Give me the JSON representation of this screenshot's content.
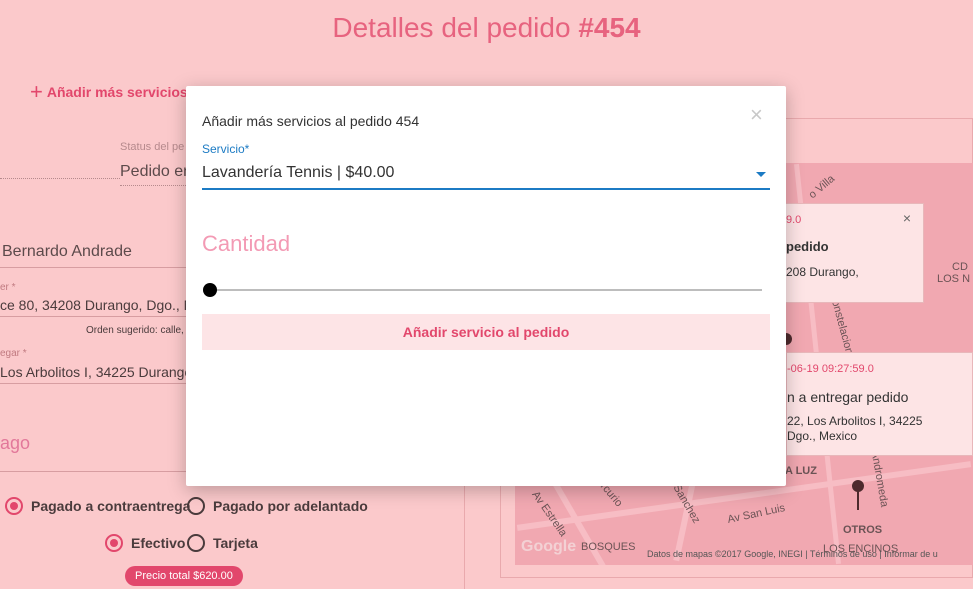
{
  "page": {
    "title_prefix": "Detalles del pedido",
    "title_number": "#454",
    "add_services_link": "Añadir más servicios"
  },
  "order_form": {
    "status_label": "Status del pe",
    "status_value": "Pedido en",
    "client_name": "Bernardo Andrade",
    "pickup_label": "er *",
    "pickup_address": "ce 80, 34208 Durango, Dgo., M",
    "order_hint": "Orden sugerido: calle,",
    "delivery_label": "egar *",
    "delivery_address": "Los Arbolitos I, 34225 Durango",
    "payment_title": "ago",
    "payment_options": [
      "Pagado a contraentrega",
      "Pagado por adelantado"
    ],
    "payment_selected": "Pagado a contraentrega",
    "method_options": [
      "Efectivo",
      "Tarjeta"
    ],
    "method_selected": "Efectivo",
    "total_badge": "Precio total $620.00"
  },
  "map": {
    "info1": {
      "date": "9.0",
      "title": "pedido",
      "address": "208 Durango,",
      "close": "×"
    },
    "info2": {
      "date": "-06-19 09:27:59.0",
      "title": "n a entregar pedido",
      "address_line1": "22, Los Arbolitos I, 34225",
      "address_line2": "Dgo., Mexico"
    },
    "labels": {
      "villa": "o Villa",
      "cd": "CD",
      "los_n": "LOS N",
      "luz": "A LUZ",
      "otros": "OTROS",
      "los_encinos": "LOS ENCINOS",
      "bosques": "BOSQUES",
      "av_san_luis": "Av San Luis",
      "av_estrella": "Av Estrella",
      "andromeda": "Andromeda",
      "constelaciones": "Constelaciones",
      "sanchez": "Sanchez",
      "mercurio": "Mercurio"
    },
    "google": "Google",
    "footer": "Datos de mapas ©2017 Google, INEGI  |  Términos de uso  |  Informar de u"
  },
  "modal": {
    "title": "Añadir más servicios al pedido 454",
    "close_glyph": "×",
    "service_label": "Servicio*",
    "service_value": "Lavandería Tennis | $40.00",
    "quantity_label": "Cantidad",
    "quantity_value": 0,
    "submit_label": "Añadir servicio al pedido"
  },
  "colors": {
    "accent": "#e2476c",
    "backdrop": "#fbc9cb",
    "field_focus": "#1c7bc4"
  }
}
